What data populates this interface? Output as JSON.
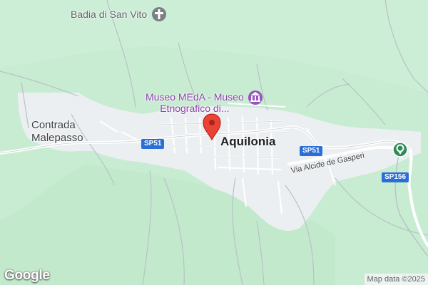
{
  "map": {
    "places": {
      "contrada": "Contrada\nMalepasso",
      "town": "Aquilonia"
    },
    "poi": {
      "badia": "Badia di San Vito",
      "museum": "Museo MEdA - Museo\nEtnografico di..."
    },
    "roads": {
      "sp51_west": "SP51",
      "sp51_east": "SP51",
      "sp156": "SP156",
      "via_alcide": "Via Alcide de Gasperi"
    },
    "icons": {
      "badia": "place-of-worship-icon",
      "museum": "museum-icon",
      "green_poi": "park-icon",
      "pin": "map-pin-icon"
    },
    "colors": {
      "land": "#c8ecd2",
      "urban": "#eef0f1",
      "museum": "#8e44ad",
      "pin": "#ea4335",
      "shield": "#2b6fd6"
    },
    "logo": "Google",
    "attribution": "Map data ©2025"
  }
}
